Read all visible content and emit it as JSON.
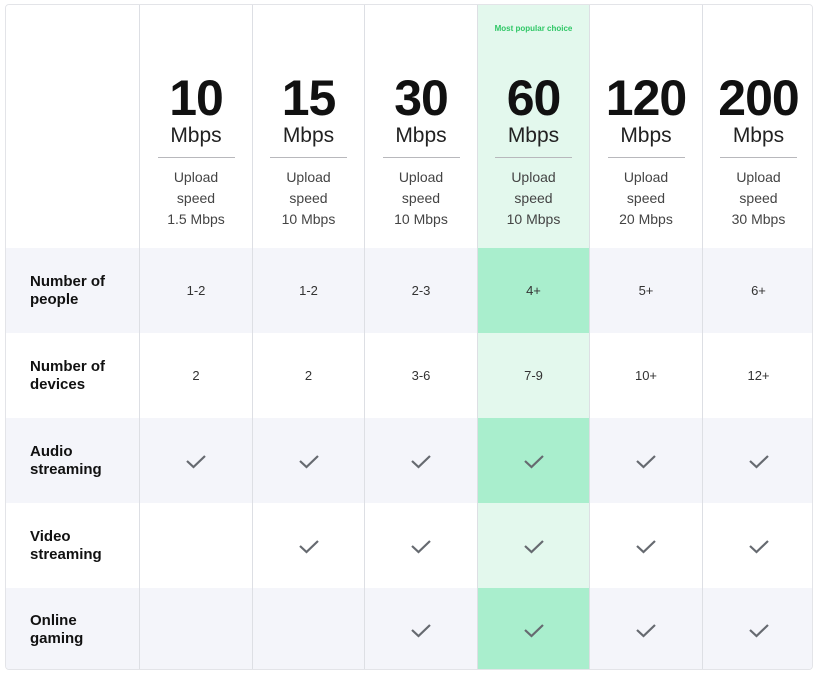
{
  "plans": [
    {
      "speed": "10",
      "unit": "Mbps",
      "upload": [
        "Upload",
        "speed",
        "1.5 Mbps"
      ],
      "badge": ""
    },
    {
      "speed": "15",
      "unit": "Mbps",
      "upload": [
        "Upload",
        "speed",
        "10 Mbps"
      ],
      "badge": ""
    },
    {
      "speed": "30",
      "unit": "Mbps",
      "upload": [
        "Upload",
        "speed",
        "10 Mbps"
      ],
      "badge": ""
    },
    {
      "speed": "60",
      "unit": "Mbps",
      "upload": [
        "Upload",
        "speed",
        "10 Mbps"
      ],
      "badge": "Most popular choice",
      "highlighted": true
    },
    {
      "speed": "120",
      "unit": "Mbps",
      "upload": [
        "Upload",
        "speed",
        "20 Mbps"
      ],
      "badge": ""
    },
    {
      "speed": "200",
      "unit": "Mbps",
      "upload": [
        "Upload",
        "speed",
        "30 Mbps"
      ],
      "badge": ""
    }
  ],
  "rows": [
    {
      "label": [
        "Number of",
        "people"
      ],
      "type": "text",
      "values": [
        "1-2",
        "1-2",
        "2-3",
        "4+",
        "5+",
        "6+"
      ]
    },
    {
      "label": [
        "Number of",
        "devices"
      ],
      "type": "text",
      "values": [
        "2",
        "2",
        "3-6",
        "7-9",
        "10+",
        "12+"
      ]
    },
    {
      "label": [
        "Audio",
        "streaming"
      ],
      "type": "check",
      "values": [
        true,
        true,
        true,
        true,
        true,
        true
      ]
    },
    {
      "label": [
        "Video",
        "streaming"
      ],
      "type": "check",
      "values": [
        false,
        true,
        true,
        true,
        true,
        true
      ]
    },
    {
      "label": [
        "Online",
        "gaming"
      ],
      "type": "check",
      "values": [
        false,
        false,
        true,
        true,
        true,
        true
      ]
    }
  ],
  "colors": {
    "highlight_light": "#e3f8ed",
    "highlight_strong": "#a9eecd",
    "badge": "#2fc766",
    "row_alt": "#f4f5fa",
    "check": "#666a70"
  }
}
